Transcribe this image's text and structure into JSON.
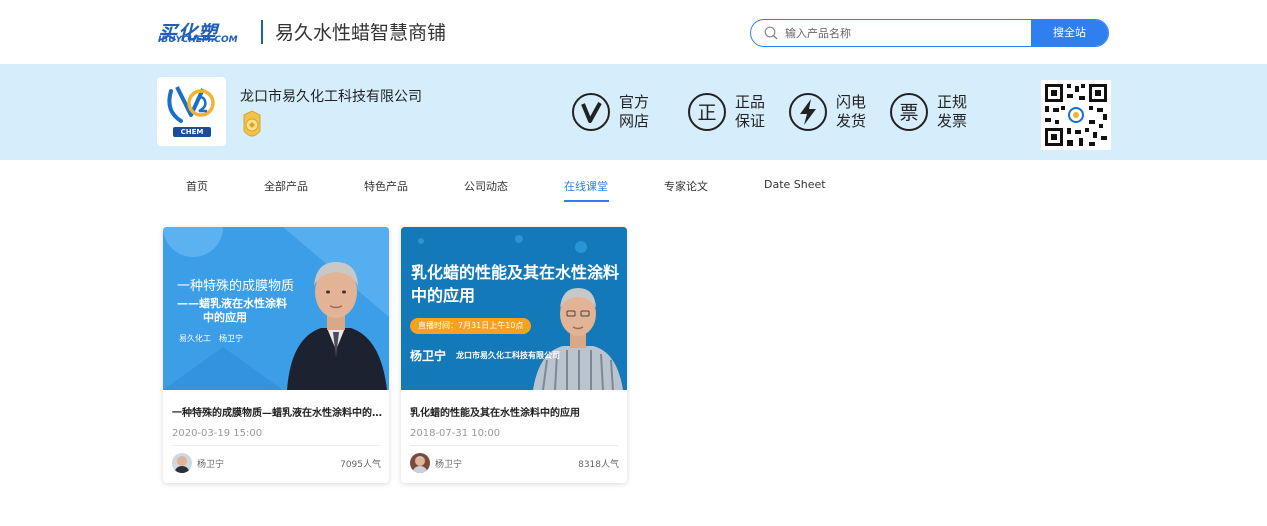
{
  "header": {
    "logo_main": "买化塑",
    "logo_sub": "IBUYCHEM.COM",
    "shop_name": "易久水性蜡智慧商铺",
    "search": {
      "placeholder": "输入产品名称",
      "button_label": "搜全站"
    }
  },
  "banner": {
    "company_name": "龙口市易久化工科技有限公司",
    "logo_text": "CHEM",
    "features": [
      {
        "icon": "v-check-icon",
        "line1": "官方",
        "line2": "网店"
      },
      {
        "icon": "genuine-icon",
        "glyph": "正",
        "line1": "正品",
        "line2": "保证"
      },
      {
        "icon": "lightning-icon",
        "line1": "闪电",
        "line2": "发货"
      },
      {
        "icon": "invoice-icon",
        "glyph": "票",
        "line1": "正规",
        "line2": "发票"
      }
    ]
  },
  "nav": {
    "items": [
      {
        "label": "首页",
        "active": false
      },
      {
        "label": "全部产品",
        "active": false
      },
      {
        "label": "特色产品",
        "active": false
      },
      {
        "label": "公司动态",
        "active": false
      },
      {
        "label": "在线课堂",
        "active": true
      },
      {
        "label": "专家论文",
        "active": false
      },
      {
        "label": "Date Sheet",
        "active": false
      }
    ]
  },
  "courses": [
    {
      "thumb": {
        "line1": "一种特殊的成膜物质",
        "line2": "——蜡乳液在水性涂料",
        "line3": "中的应用",
        "meta": "易久化工　杨卫宁"
      },
      "title": "一种特殊的成膜物质—蜡乳液在水性涂料中的应用",
      "date": "2020-03-19 15:00",
      "author": "杨卫宁",
      "views": "7095人气"
    },
    {
      "thumb": {
        "headline": "乳化蜡的性能及其在水性涂料中的应用",
        "pill": "直播时间：7月31日上午10点",
        "name": "杨卫宁",
        "org": "龙口市易久化工科技有限公司"
      },
      "title": "乳化蜡的性能及其在水性涂料中的应用",
      "date": "2018-07-31 10:00",
      "author": "杨卫宁",
      "views": "8318人气"
    }
  ],
  "colors": {
    "accent": "#2f7ff0",
    "banner_bg": "#d6eefc",
    "brand": "#1f5fb8"
  }
}
